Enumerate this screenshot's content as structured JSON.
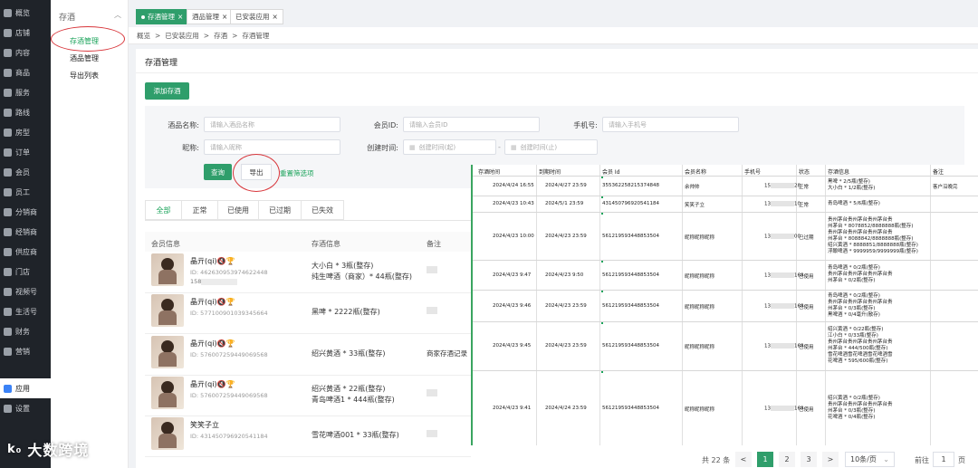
{
  "nav": [
    {
      "label": "概览"
    },
    {
      "label": "店铺"
    },
    {
      "label": "内容"
    },
    {
      "label": "商品"
    },
    {
      "label": "服务"
    },
    {
      "label": "路线"
    },
    {
      "label": "房型"
    },
    {
      "label": "订单"
    },
    {
      "label": "会员"
    },
    {
      "label": "员工"
    },
    {
      "label": "分销商"
    },
    {
      "label": "经销商"
    },
    {
      "label": "供应商"
    },
    {
      "label": "门店"
    },
    {
      "label": "视频号"
    },
    {
      "label": "生活号"
    },
    {
      "label": "财务"
    },
    {
      "label": "营销"
    },
    {
      "label": "应用"
    },
    {
      "label": "设置"
    }
  ],
  "sub": {
    "header": "存酒",
    "items": [
      {
        "label": "存酒管理"
      },
      {
        "label": "酒品管理"
      },
      {
        "label": "导出列表"
      }
    ]
  },
  "tabs": [
    {
      "label": "存酒管理",
      "close": "×"
    },
    {
      "label": "酒品管理",
      "close": "×"
    },
    {
      "label": "已安装应用",
      "close": "×"
    }
  ],
  "breadcrumb": [
    "概览",
    "已安装应用",
    "存酒",
    "存酒管理"
  ],
  "breadcrumb_sep": ">",
  "page_title": "存酒管理",
  "add_button": "添加存酒",
  "filters": {
    "wine_label": "酒品名称:",
    "wine_ph": "请输入酒品名称",
    "member_label": "会员ID:",
    "member_ph": "请输入会员ID",
    "phone_label": "手机号:",
    "phone_ph": "请输入手机号",
    "nick_label": "昵称:",
    "nick_ph": "请输入昵称",
    "time_label": "创建时间:",
    "start_ph": "创建时间(起)",
    "end_ph": "创建时间(止)",
    "search_btn": "查询",
    "export_btn": "导出",
    "reset_btn": "重置筛选项"
  },
  "status_tabs": [
    {
      "label": "全部"
    },
    {
      "label": "正常"
    },
    {
      "label": "已使用"
    },
    {
      "label": "已过期"
    },
    {
      "label": "已失效"
    }
  ],
  "table": {
    "headers": {
      "member": "会员信息",
      "info": "存酒信息",
      "remark": "备注"
    },
    "rows": [
      {
        "name": "晶亓(qi)🔇🏆",
        "id": "ID: 462630953974622448",
        "phone": "158",
        "info": [
          "大小白 * 3瓶(整存)",
          "纯生啤酒（商家）* 44瓶(整存)"
        ],
        "remark": ""
      },
      {
        "name": "晶亓(qi)🔇🏆",
        "id": "ID: 577100901039345664",
        "phone": "",
        "info": [
          "黑啤 * 2222瓶(整存)"
        ],
        "remark": ""
      },
      {
        "name": "晶亓(qi)🔇🏆",
        "id": "ID: 576007259449069568",
        "phone": "",
        "info": [
          "绍兴黄酒 * 33瓶(整存)"
        ],
        "remark": "商家存酒记录"
      },
      {
        "name": "晶亓(qi)🔇🏆",
        "id": "ID: 576007259449069568",
        "phone": "",
        "info": [
          "绍兴黄酒 * 22瓶(整存)",
          "青岛啤酒1 * 444瓶(整存)"
        ],
        "remark": ""
      },
      {
        "name": "笑笑子立",
        "id": "ID: 431450796920541184",
        "phone": "",
        "info": [
          "雪花啤酒001 * 33瓶(整存)"
        ],
        "remark": ""
      }
    ]
  },
  "sheet": {
    "headers": [
      "存酒时间",
      "到期时间",
      "会员 Id",
      "会员名称",
      "手机号",
      "状态",
      "存酒信息",
      "备注"
    ],
    "rows": [
      {
        "t": "2024/4/24 16:55",
        "e": "2024/4/27 23:59",
        "id": "355362258215374848",
        "name": "余帅帅",
        "phone_a": "15",
        "phone_b": "28",
        "status": "正常",
        "info": "黑啤 * 2/5瓶(整存)\n大小白 * 1/2瓶(整存)",
        "remark": "客户沿晚完"
      },
      {
        "t": "2024/4/23 10:43",
        "e": "2024/5/1 23:59",
        "id": "431450796920541184",
        "name": "笑笑子立",
        "phone_a": "13",
        "phone_b": "10",
        "status": "正常",
        "info": "青岛啤酒 * 5/6瓶(整存)",
        "remark": ""
      },
      {
        "t": "2024/4/23 10:00",
        "e": "2024/4/23 23:59",
        "id": "561219593448853504",
        "name": "昵称昵称昵称",
        "phone_a": "13",
        "phone_b": "00",
        "status": "已过期",
        "info": "贵州茅台贵州茅台贵州茅台贵\n州茅台 * 8078852/8888888瓶(整存)\n贵州茅台贵州茅台贵州茅台贵\n州茅台 * 8088842/8888888瓶(整存)\n绍兴黄酒 * 8888851/8888888瓶(整存)\n浮酿啤酒 * 9999959/9999999瓶(整存)",
        "remark": ""
      },
      {
        "t": "2024/4/23 9:47",
        "e": "2024/4/23 9:50",
        "id": "561219593448853504",
        "name": "昵称昵称昵称",
        "phone_a": "13",
        "phone_b": "168",
        "status": "已使用",
        "info": "青岛啤酒 * 0/2瓶(整存)\n贵州茅台贵州茅台贵州茅台贵\n州茅台 * 0/2瓶(整存)",
        "remark": ""
      },
      {
        "t": "2024/4/23 9:46",
        "e": "2024/4/23 23:59",
        "id": "561219593448853504",
        "name": "昵称昵称昵称",
        "phone_a": "13",
        "phone_b": "168",
        "status": "已使用",
        "info": "青岛啤酒 * 0/2瓶(整存)\n贵州茅台贵州茅台贵州茅台贵\n州茅台 * 0/3瓶(整存)\n黑啤酒 * 0/4毫升(散存)",
        "remark": ""
      },
      {
        "t": "2024/4/23 9:45",
        "e": "2024/4/23 23:59",
        "id": "561219593448853504",
        "name": "昵称昵称昵称",
        "phone_a": "13",
        "phone_b": "168",
        "status": "已使用",
        "info": "绍兴黄酒 * 0/22瓶(整存)\n江小白 * 0/33瓶(整存)\n贵州茅台贵州茅台贵州茅台贵\n州茅台 * 444/500瓶(整存)\n雪花啤酒雪花啤酒雪花啤酒雪\n花啤酒 * 595/600瓶(整存)",
        "remark": ""
      },
      {
        "t": "2024/4/23 9:41",
        "e": "2024/4/24 23:59",
        "id": "561219593448853504",
        "name": "昵称昵称昵称",
        "phone_a": "13",
        "phone_b": "168",
        "status": "已使用",
        "info": "绍兴黄酒 * 0/2瓶(整存)\n贵州茅台贵州茅台贵州茅台贵\n州茅台 * 0/3瓶(整存)\n花啤酒 * 0/4瓶(整存)",
        "remark": ""
      }
    ]
  },
  "pagination": {
    "total": "共 22 条",
    "prev": "<",
    "pages": [
      "1",
      "2",
      "3"
    ],
    "next": ">",
    "size": "10条/页",
    "goto": "前往",
    "page_val": "1",
    "page_unit": "页"
  },
  "watermark": {
    "logo": "k₀",
    "text": "大数跨境"
  }
}
